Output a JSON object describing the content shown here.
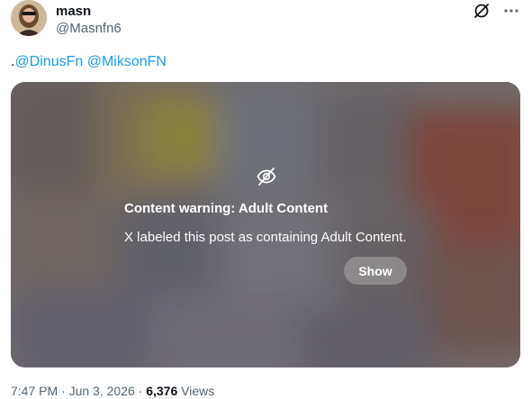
{
  "author": {
    "name": "masn",
    "handle": "@Masnfn6"
  },
  "post": {
    "prefix": ".",
    "mentions": [
      "@DinusFn",
      "@MiksonFN"
    ]
  },
  "content_warning": {
    "title": "Content warning: Adult Content",
    "text": "X labeled this post as containing Adult Content.",
    "show_label": "Show"
  },
  "meta": {
    "time": "7:47 PM",
    "separator1": " · ",
    "date": "Jun 3, 2026",
    "separator2": " · ",
    "views_count": "6,376",
    "views_label": " Views"
  },
  "icons": {
    "grok": "grok-slash-icon",
    "more": "more-dots-icon",
    "hidden": "eye-slash-icon"
  }
}
